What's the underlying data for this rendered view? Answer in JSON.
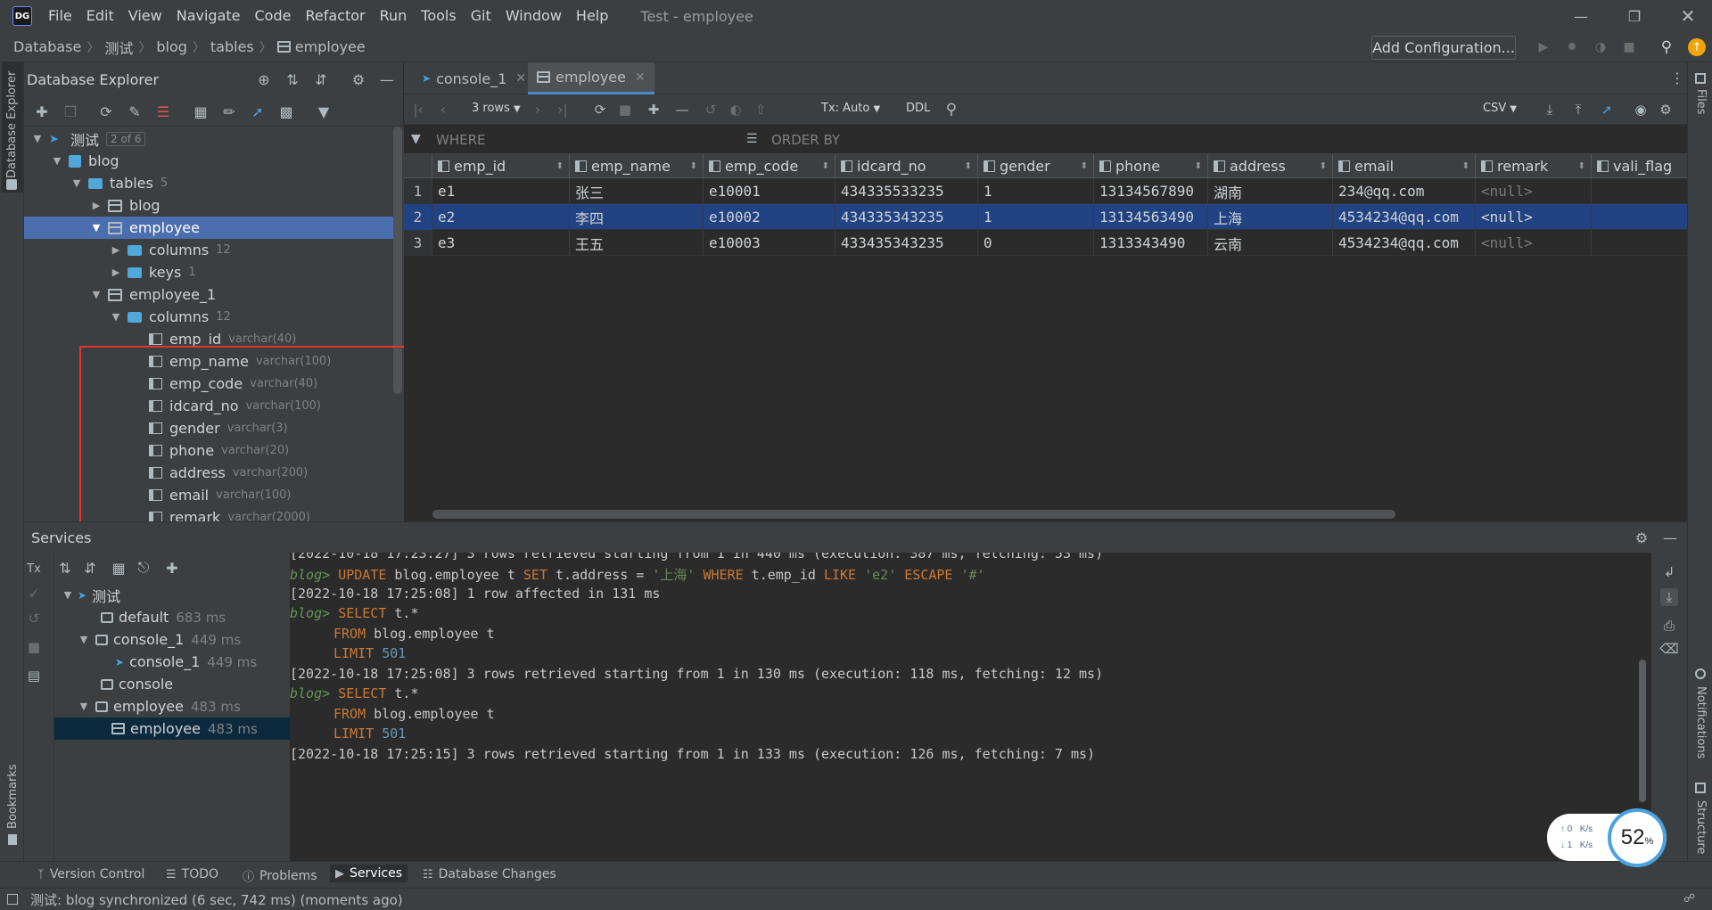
{
  "titlebar": {
    "menu": [
      "File",
      "Edit",
      "View",
      "Navigate",
      "Code",
      "Refactor",
      "Run",
      "Tools",
      "Git",
      "Window",
      "Help"
    ],
    "title": "Test - employee"
  },
  "breadcrumb": [
    "Database",
    "测试",
    "blog",
    "tables",
    "employee"
  ],
  "navbar": {
    "add_configuration": "Add Configuration..."
  },
  "db_explorer": {
    "title": "Database Explorer",
    "tree": {
      "root": {
        "label": "测试",
        "badge": "2 of 6"
      },
      "blog": "blog",
      "tables": {
        "label": "tables",
        "count": "5"
      },
      "blog_table": "blog",
      "employee": "employee",
      "columns": {
        "label": "columns",
        "count": "12"
      },
      "keys": {
        "label": "keys",
        "count": "1"
      },
      "employee_1": "employee_1",
      "columns_1": {
        "label": "columns",
        "count": "12"
      },
      "cols": [
        {
          "name": "emp_id",
          "type": "varchar(40)"
        },
        {
          "name": "emp_name",
          "type": "varchar(100)"
        },
        {
          "name": "emp_code",
          "type": "varchar(40)"
        },
        {
          "name": "idcard_no",
          "type": "varchar(100)"
        },
        {
          "name": "gender",
          "type": "varchar(3)"
        },
        {
          "name": "phone",
          "type": "varchar(20)"
        },
        {
          "name": "address",
          "type": "varchar(200)"
        },
        {
          "name": "email",
          "type": "varchar(100)"
        },
        {
          "name": "remark",
          "type": "varchar(2000)"
        }
      ]
    }
  },
  "left_stripe": {
    "db_explorer": "Database Explorer",
    "bookmarks": "Bookmarks"
  },
  "right_stripe": {
    "files": "Files",
    "notifications": "Notifications",
    "structure": "Structure"
  },
  "editor": {
    "tabs": [
      {
        "label": "console_1"
      },
      {
        "label": "employee"
      }
    ],
    "toolbar": {
      "rows": "3 rows",
      "tx": "Tx: Auto",
      "ddl": "DDL",
      "export": "CSV"
    },
    "filter": {
      "where": "WHERE",
      "order_by": "ORDER BY"
    },
    "grid": {
      "columns": [
        "emp_id",
        "emp_name",
        "emp_code",
        "idcard_no",
        "gender",
        "phone",
        "address",
        "email",
        "remark",
        "vali_flag"
      ],
      "rows": [
        {
          "n": "1",
          "cells": [
            "e1",
            "张三",
            "e10001",
            "434335533235",
            "1",
            "13134567890",
            "湖南",
            "234@qq.com",
            "<null>",
            ""
          ]
        },
        {
          "n": "2",
          "cells": [
            "e2",
            "李四",
            "e10002",
            "434335343235",
            "1",
            "13134563490",
            "上海",
            "4534234@qq.com",
            "<null>",
            ""
          ]
        },
        {
          "n": "3",
          "cells": [
            "e3",
            "王五",
            "e10003",
            "433435343235",
            "0",
            "1313343490",
            "云南",
            "4534234@qq.com",
            "<null>",
            ""
          ]
        }
      ],
      "selected_row": 2
    }
  },
  "services": {
    "title": "Services",
    "tree": [
      {
        "label": "测试",
        "ms": ""
      },
      {
        "label": "default",
        "ms": "683 ms"
      },
      {
        "label": "console_1",
        "ms": "449 ms"
      },
      {
        "label": "console_1",
        "ms": "449 ms"
      },
      {
        "label": "console",
        "ms": ""
      },
      {
        "label": "employee",
        "ms": "483 ms"
      },
      {
        "label": "employee",
        "ms": "483 ms"
      }
    ],
    "console": {
      "l0": "[2022-10-18 17:23:27] 3 rows retrieved starting from 1 in 440 ms (execution: 387 ms, fetching: 53 ms)",
      "prompt": "blog>",
      "update_kw": "UPDATE",
      "update_mid": " blog.employee t ",
      "set_kw": "SET",
      "set_mid": " t.address = ",
      "update_val": "'上海'",
      "where_kw": "WHERE",
      "where_mid": " t.emp_id ",
      "like_kw": "LIKE",
      "like_val": "'e2'",
      "escape_kw": "ESCAPE",
      "escape_val": "'#'",
      "l2": "[2022-10-18 17:25:08] 1 row affected in 131 ms",
      "select_kw": "SELECT",
      "select_mid": " t.*",
      "from_kw": "FROM",
      "from_mid": " blog.employee t",
      "limit_kw": "LIMIT",
      "limit_val": "501",
      "l6": "[2022-10-18 17:25:08] 3 rows retrieved starting from 1 in 130 ms (execution: 118 ms, fetching: 12 ms)",
      "l10": "[2022-10-18 17:25:15] 3 rows retrieved starting from 1 in 133 ms (execution: 126 ms, fetching: 7 ms)"
    }
  },
  "bottom_tabs": [
    "Version Control",
    "TODO",
    "Problems",
    "Services",
    "Database Changes"
  ],
  "status": "测试: blog synchronized (6 sec, 742 ms) (moments ago)",
  "net_widget": {
    "up": "0",
    "down": "1",
    "unit": "K/s",
    "percent": "52",
    "percent_sign": "%"
  },
  "colors": {
    "accent": "#4a88c7",
    "selection": "#4b6eaf",
    "highlight_box": "#e0362f",
    "keyword": "#cc7832"
  }
}
